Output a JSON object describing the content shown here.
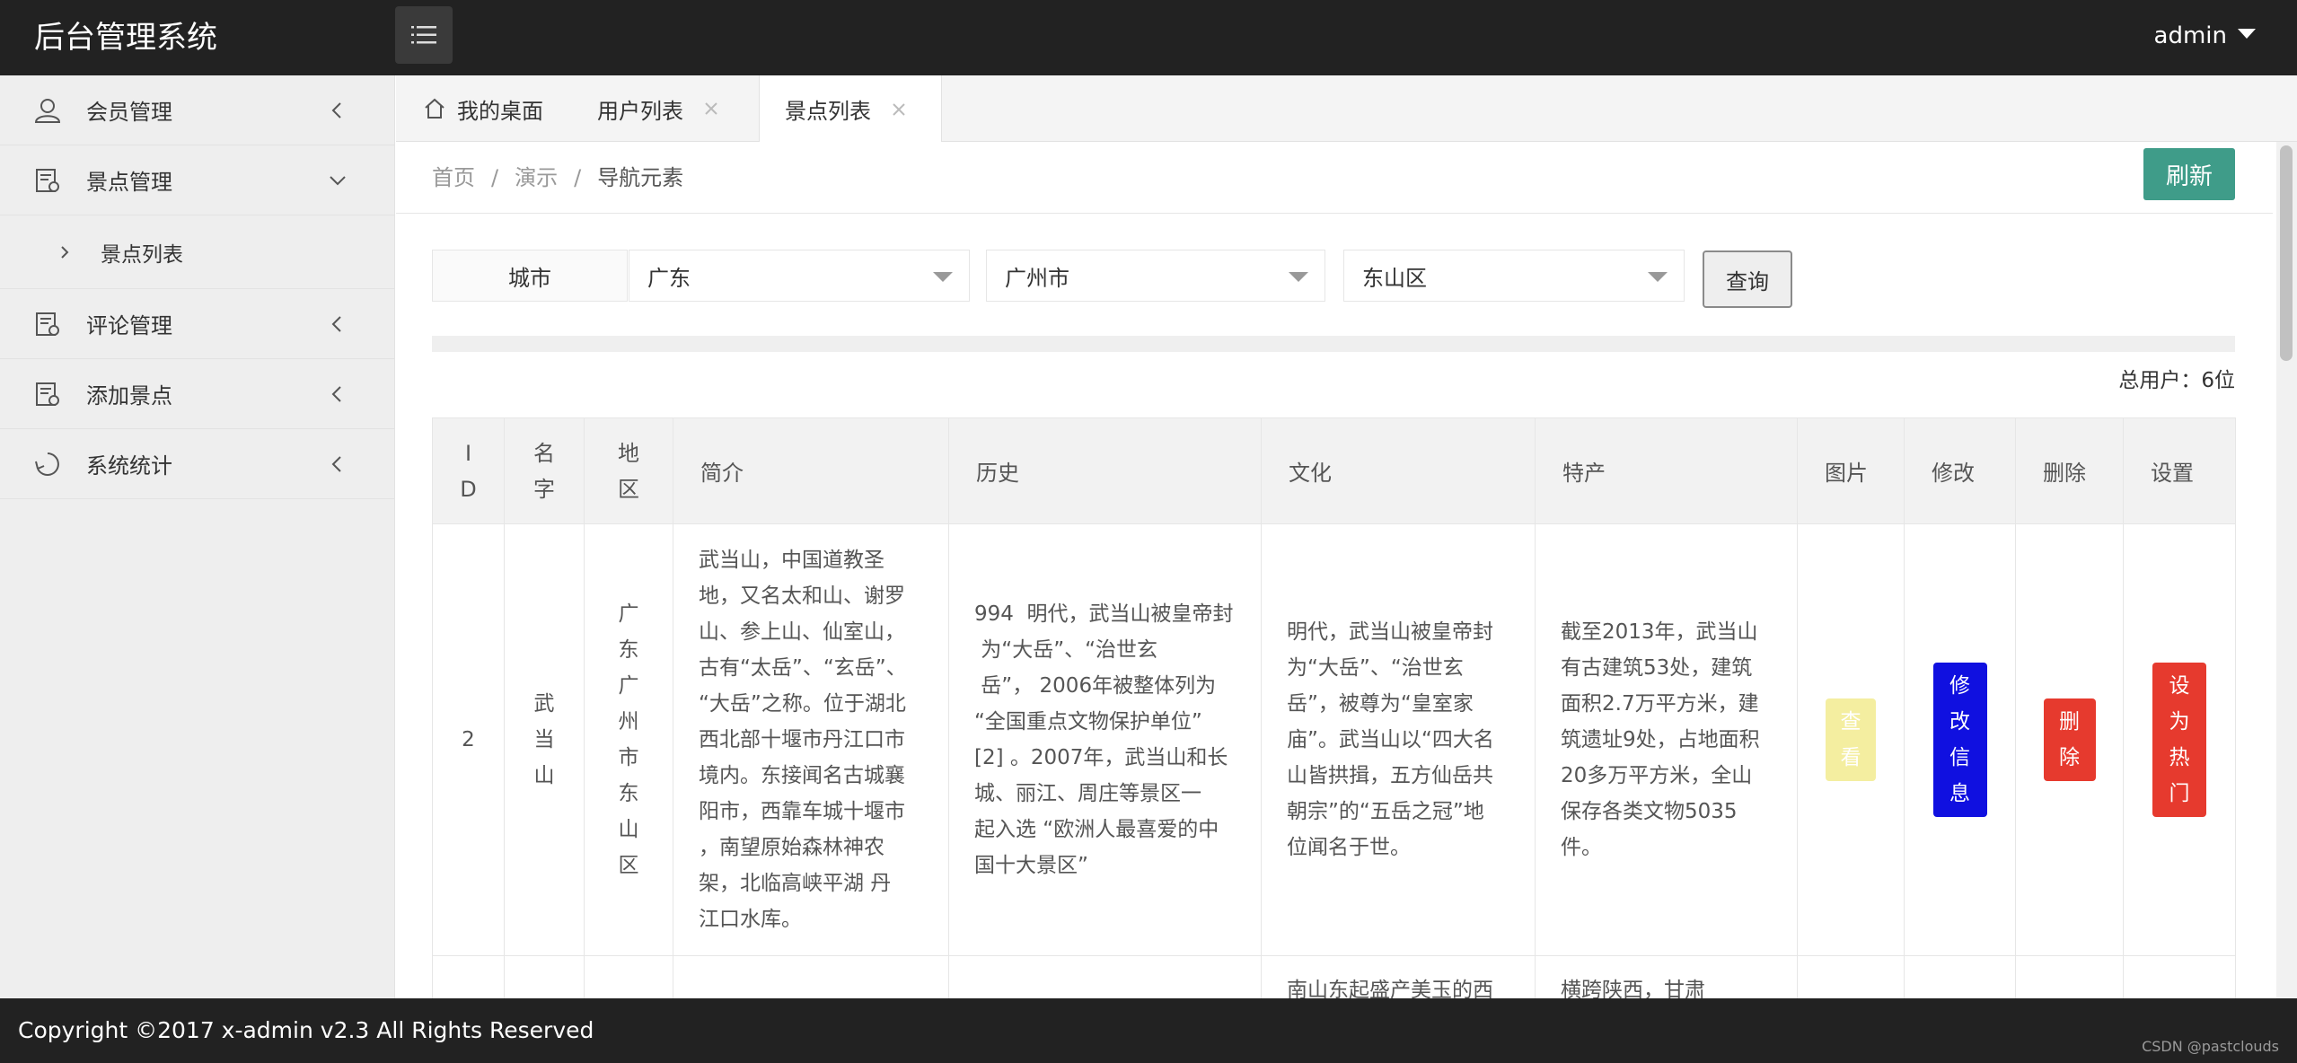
{
  "header": {
    "logo": "后台管理系统",
    "user": "admin"
  },
  "sidebar": {
    "items": [
      {
        "label": "会员管理",
        "icon": "user-icon"
      },
      {
        "label": "景点管理",
        "icon": "document-icon",
        "expanded": true
      },
      {
        "label": "评论管理",
        "icon": "document-icon"
      },
      {
        "label": "添加景点",
        "icon": "document-icon"
      },
      {
        "label": "系统统计",
        "icon": "chart-icon"
      }
    ],
    "subitem": {
      "label": "景点列表"
    }
  },
  "tabs": [
    {
      "label": "我的桌面",
      "icon": "home-icon"
    },
    {
      "label": "用户列表"
    },
    {
      "label": "景点列表",
      "active": true
    }
  ],
  "breadcrumb": {
    "items": [
      "首页",
      "演示",
      "导航元素"
    ],
    "separator": "/"
  },
  "toolbar": {
    "refresh_label": "刷新",
    "refresh_color": "#3f9c89"
  },
  "filter": {
    "label": "城市",
    "province": "广东",
    "city": "广州市",
    "district": "东山区",
    "query_label": "查询"
  },
  "summary": {
    "total": "总用户：6位"
  },
  "table": {
    "headers": {
      "id": [
        "I",
        "D"
      ],
      "name": [
        "名",
        "字"
      ],
      "region": [
        "地",
        "区"
      ],
      "intro": "简介",
      "history": "历史",
      "culture": "文化",
      "specialty": "特产",
      "image": "图片",
      "edit": "修改",
      "delete": "删除",
      "settings": "设置"
    },
    "rows": [
      {
        "id": "2",
        "name": [
          "武",
          "当",
          "山"
        ],
        "region": [
          "广",
          "东",
          "广",
          "州",
          "市",
          "东",
          "山",
          "区"
        ],
        "intro": [
          "武当山，中国道教圣",
          "地，又名太和山、谢罗",
          "山、参上山、仙室山，",
          "古有“太岳”、“玄岳”、",
          "“大岳”之称。位于湖北",
          "西北部十堰市丹江口市",
          "境内。东接闻名古城襄",
          "阳市，西靠车城十堰市",
          "，南望原始森林神农",
          "架，北临高峡平湖 丹",
          "江口水库。"
        ],
        "history": [
          "994  明代，武当山被皇帝封",
          " 为“大岳”、“治世玄",
          " 岳”， 2006年被整体列为",
          "“全国重点文物保护单位”",
          "[2] 。2007年，武当山和长",
          "城、丽江、周庄等景区一",
          "起入选 “欧洲人最喜爱的中",
          "国十大景区”"
        ],
        "culture": [
          "明代，武当山被皇帝封",
          "为“大岳”、“治世玄",
          "岳”，被尊为“皇室家",
          "庙”。武当山以“四大名",
          "山皆拱揖，五方仙岳共",
          "朝宗”的“五岳之冠”地",
          "位闻名于世。"
        ],
        "specialty": [
          "截至2013年，武当山",
          "有古建筑53处，建筑",
          "面积2.7万平方米，建",
          "筑遗址9处，占地面积",
          "20多万平方米，全山",
          "保存各类文物5035",
          "件。"
        ],
        "view_btn": [
          "查",
          "看"
        ],
        "edit_btn": [
          "修",
          "改",
          "信",
          "息"
        ],
        "delete_btn": [
          "删",
          "除"
        ],
        "hot_btn": [
          "设",
          "为",
          "热",
          "门"
        ]
      },
      {
        "culture": "南山东起盛产美玉的西",
        "specialty": "横跨陕西，甘肃"
      }
    ]
  },
  "footer": {
    "copyright": "Copyright ©2017 x-admin v2.3 All Rights Reserved",
    "watermark": "CSDN @pastclouds"
  }
}
